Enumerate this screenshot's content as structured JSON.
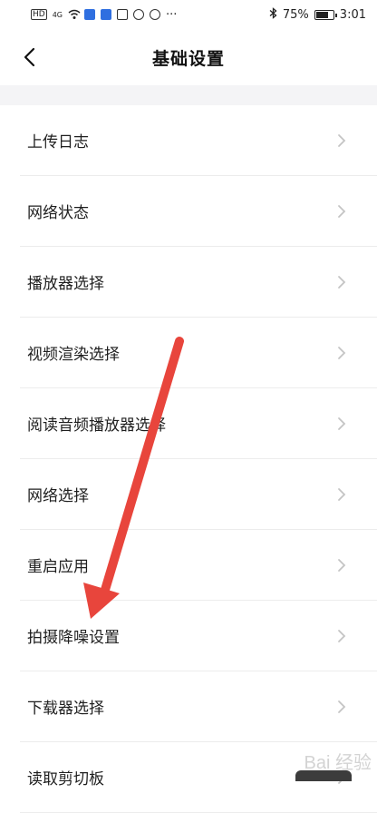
{
  "status_bar": {
    "left_text": "HD",
    "signal_label": "4G",
    "dots": "···",
    "battery_percent": "75%",
    "time": "3:01",
    "battery_level": 0.75
  },
  "header": {
    "title": "基础设置"
  },
  "settings_items": [
    {
      "label": "上传日志"
    },
    {
      "label": "网络状态"
    },
    {
      "label": "播放器选择"
    },
    {
      "label": "视频渲染选择"
    },
    {
      "label": "阅读音频播放器选择"
    },
    {
      "label": "网络选择"
    },
    {
      "label": "重启应用"
    },
    {
      "label": "拍摄降噪设置"
    },
    {
      "label": "下载器选择"
    },
    {
      "label": "读取剪切板"
    }
  ],
  "annotation": {
    "arrow_color": "#e8453c"
  },
  "watermark": {
    "text": "Bai 经验"
  },
  "colors": {
    "chevron": "#c4c4c4",
    "band": "#f4f4f6"
  }
}
